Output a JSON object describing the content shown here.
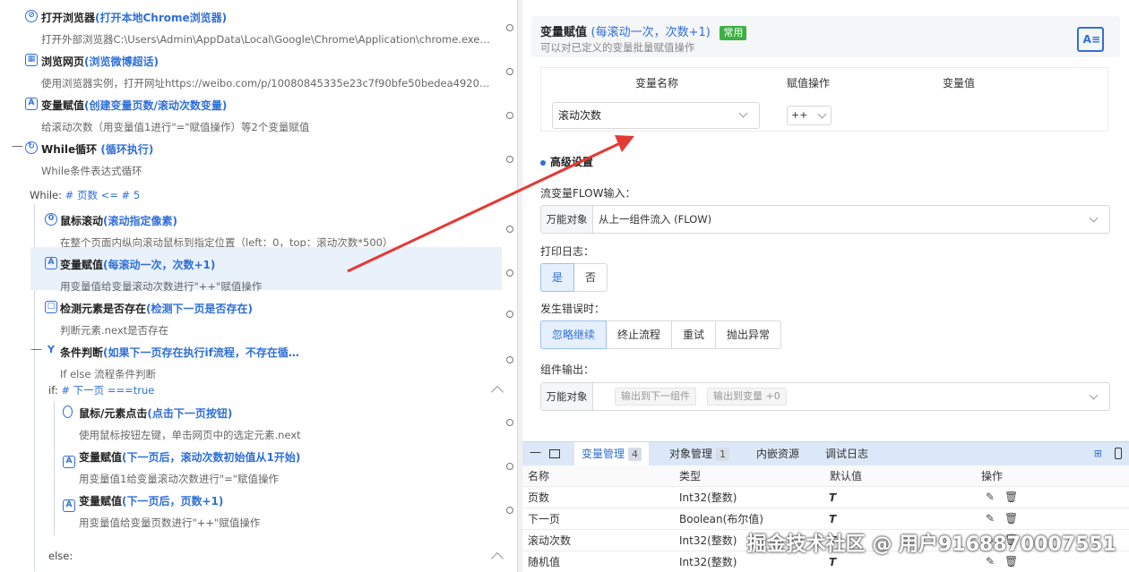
{
  "flow": {
    "steps": [
      {
        "title": "打开浏览器",
        "highlight": "(打开本地Chrome浏览器)",
        "desc": "打开外部浏览器C:\\Users\\Admin\\AppData\\Local\\Google\\Chrome\\Application\\chrome.exe，设…",
        "icon": "compass-icon"
      },
      {
        "title": "浏览网页",
        "highlight": "(浏览微博超话)",
        "desc": "使用浏览器实例，打开网址https://weibo.com/p/10080845335e23c7f90bfe50bedea4920a594…",
        "icon": "browser-window-icon"
      },
      {
        "title": "变量赋值",
        "highlight": "(创建变量页数/滚动次数变量)",
        "desc": "给滚动次数（用变量值1进行\"=\"赋值操作）等2个变量赋值",
        "icon": "variable-assign-icon"
      },
      {
        "title": "While循环",
        "highlight": "(循环执行)",
        "desc": "While条件表达式循环",
        "icon": "loop-icon"
      },
      {
        "title": "鼠标滚动",
        "highlight": "(滚动指定像素)",
        "desc": "在整个页面内纵向滚动鼠标到指定位置（left：0，top：滚动次数*500）",
        "icon": "mouse-scroll-icon"
      },
      {
        "title": "变量赋值",
        "highlight": "(每滚动一次，次数+1)",
        "desc": "用变量值给变量滚动次数进行\"++\"赋值操作",
        "icon": "variable-assign-icon"
      },
      {
        "title": "检测元素是否存在",
        "highlight": "(检测下一页是否存在)",
        "desc": "判断元素.next是否存在",
        "icon": "element-check-icon"
      },
      {
        "title": "条件判断",
        "highlight": "(如果下一页存在执行if流程，不存在循…",
        "desc": "If else 流程条件判断",
        "icon": "condition-icon"
      },
      {
        "title": "鼠标/元素点击",
        "highlight": "(点击下一页按钮)",
        "desc": "使用鼠标按钮左键，单击网页中的选定元素.next",
        "icon": "mouse-click-icon"
      },
      {
        "title": "变量赋值",
        "highlight": "(下一页后，滚动次数初始值从1开始)",
        "desc": "用变量值1给变量滚动次数进行\"=\"赋值操作",
        "icon": "variable-assign-icon"
      },
      {
        "title": "变量赋值",
        "highlight": "(下一页后，页数+1)",
        "desc": "用变量值给变量页数进行\"++\"赋值操作",
        "icon": "variable-assign-icon"
      }
    ],
    "while_label": "While:",
    "while_expr": "# 页数 <= # 5",
    "if_label": "if:",
    "if_expr": "# 下一页 ===true",
    "else_label": "else:"
  },
  "config": {
    "title": "变量赋值",
    "title_highlight": "(每滚动一次，次数+1)",
    "badge": "常用",
    "subtitle": "可以对已定义的变量批量赋值操作",
    "header_icon": "variable-assign-icon",
    "table": {
      "col_name": "变量名称",
      "col_op": "赋值操作",
      "col_value": "变量值",
      "row": {
        "name": "滚动次数",
        "op": "++"
      }
    },
    "advanced_title": "高级设置",
    "flow_input_label": "流变量FLOW输入：",
    "flow_prefix": "万能对象",
    "flow_value": "从上一组件流入 (FLOW)",
    "log_label": "打印日志：",
    "log_options": [
      "是",
      "否"
    ],
    "error_label": "发生错误时：",
    "error_options": [
      "忽略继续",
      "终止流程",
      "重试",
      "抛出异常"
    ],
    "output_label": "组件输出：",
    "output_prefix": "万能对象",
    "output_tags": [
      "输出到下一组件",
      "输出到变量 +0"
    ]
  },
  "bottom": {
    "tabs": [
      {
        "label": "变量管理",
        "count": "4"
      },
      {
        "label": "对象管理",
        "count": "1"
      },
      {
        "label": "内嵌资源",
        "count": ""
      },
      {
        "label": "调试日志",
        "count": ""
      }
    ],
    "columns": [
      "名称",
      "类型",
      "默认值",
      "操作"
    ],
    "rows": [
      {
        "name": "页数",
        "type": "Int32(整数)",
        "default": "T"
      },
      {
        "name": "下一页",
        "type": "Boolean(布尔值)",
        "default": "T"
      },
      {
        "name": "滚动次数",
        "type": "Int32(整数)",
        "default": "T"
      },
      {
        "name": "随机值",
        "type": "Int32(整数)",
        "default": "T"
      }
    ]
  },
  "watermark": "掘金技术社区 @ 用户9168870007551",
  "colors": {
    "accent": "#2f6fd8",
    "badge": "#3cb043",
    "arrow": "#e53935"
  }
}
